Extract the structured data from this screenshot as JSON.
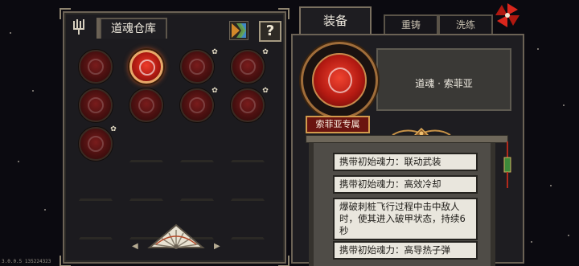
{
  "storage": {
    "tab_label": "道魂仓库",
    "help_label": "?",
    "slots": [
      {
        "state": "filled",
        "pinned": false,
        "selected": false
      },
      {
        "state": "filled",
        "pinned": false,
        "selected": true
      },
      {
        "state": "filled",
        "pinned": true,
        "selected": false
      },
      {
        "state": "filled",
        "pinned": true,
        "selected": false
      },
      {
        "state": "filled",
        "pinned": false,
        "selected": false
      },
      {
        "state": "filled",
        "pinned": false,
        "selected": false
      },
      {
        "state": "filled",
        "pinned": true,
        "selected": false
      },
      {
        "state": "filled",
        "pinned": true,
        "selected": false
      },
      {
        "state": "filled",
        "pinned": true,
        "selected": false
      },
      {
        "state": "empty"
      },
      {
        "state": "empty"
      },
      {
        "state": "empty"
      },
      {
        "state": "empty"
      },
      {
        "state": "empty"
      },
      {
        "state": "empty"
      },
      {
        "state": "empty"
      },
      {
        "state": "empty"
      },
      {
        "state": "empty"
      },
      {
        "state": "empty"
      },
      {
        "state": "empty"
      }
    ]
  },
  "tabs": {
    "equip": "装备",
    "recast": "重铸",
    "wash": "洗练"
  },
  "selected_soul": {
    "name": "道魂 · 索菲亚",
    "badge": "索菲亚专属"
  },
  "skills": [
    "携带初始魂力：联动武装",
    "携带初始魂力：高效冷却",
    "爆破刺桩飞行过程中击中敌人时，使其进入破甲状态，持续6秒",
    "携带初始魂力：高导热子弹"
  ],
  "version": "3.0.0.5  135224323",
  "colors": {
    "accent_red": "#c0201a",
    "frame_gold": "#d29a4c",
    "panel_bg": "#1e1d21",
    "skill_bg": "#e9e6dd"
  },
  "icons": [
    "fork-icon",
    "sort-icon",
    "help-icon",
    "pin-icon",
    "fan-icon",
    "pinwheel-icon",
    "tassel-icon"
  ]
}
